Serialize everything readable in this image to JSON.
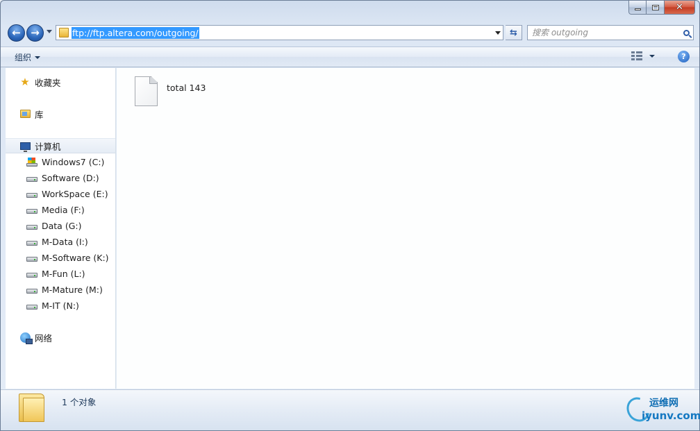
{
  "window": {
    "minimize_glyph": "minimize-icon",
    "maximize_glyph": "maximize-icon",
    "close_label": "✕"
  },
  "nav": {
    "back_icon": "back-arrow-icon",
    "forward_icon": "forward-arrow-icon",
    "address": "ftp://ftp.altera.com/outgoing/",
    "refresh_icon": "refresh-icon",
    "search_placeholder": "搜索 outgoing"
  },
  "toolbar": {
    "organize_label": "组织",
    "help_label": "?"
  },
  "sidebar": {
    "favorites": "收藏夹",
    "libraries": "库",
    "computer": "计算机",
    "drives": [
      {
        "label": "Windows7 (C:)",
        "icon": "windows-drive-icon"
      },
      {
        "label": "Software (D:)",
        "icon": "drive-icon"
      },
      {
        "label": "WorkSpace (E:)",
        "icon": "drive-icon"
      },
      {
        "label": "Media (F:)",
        "icon": "drive-icon"
      },
      {
        "label": "Data (G:)",
        "icon": "drive-icon"
      },
      {
        "label": "M-Data (I:)",
        "icon": "drive-icon"
      },
      {
        "label": "M-Software (K:)",
        "icon": "drive-icon"
      },
      {
        "label": "M-Fun (L:)",
        "icon": "drive-icon"
      },
      {
        "label": "M-Mature (M:)",
        "icon": "drive-icon"
      },
      {
        "label": "M-IT (N:)",
        "icon": "drive-icon"
      }
    ],
    "network": "网络"
  },
  "content": {
    "files": [
      {
        "name": "total 143",
        "icon": "file-icon"
      }
    ]
  },
  "details": {
    "count_text": "1 个对象"
  },
  "watermark": {
    "line1": "运维网",
    "line2": "iyunv.com"
  }
}
